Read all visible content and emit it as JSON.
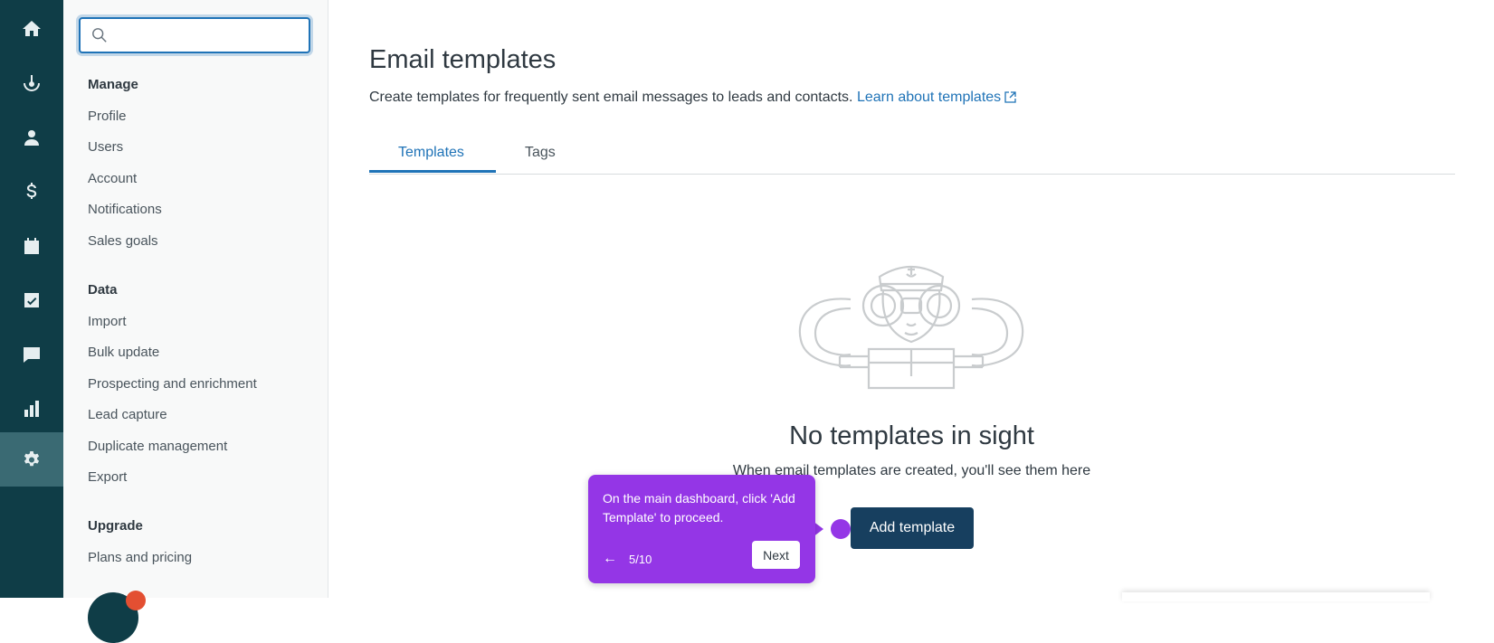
{
  "rail": {
    "items": [
      {
        "icon": "home-icon"
      },
      {
        "icon": "leads-icon"
      },
      {
        "icon": "contact-icon"
      },
      {
        "icon": "dollar-icon"
      },
      {
        "icon": "calendar-icon"
      },
      {
        "icon": "tasks-icon"
      },
      {
        "icon": "chat-icon"
      },
      {
        "icon": "reports-icon"
      },
      {
        "icon": "settings-icon",
        "active": true
      }
    ]
  },
  "sidebar": {
    "search": {
      "value": "",
      "placeholder": ""
    },
    "sections": [
      {
        "title": "Manage",
        "items": [
          "Profile",
          "Users",
          "Account",
          "Notifications",
          "Sales goals"
        ]
      },
      {
        "title": "Data",
        "items": [
          "Import",
          "Bulk update",
          "Prospecting and enrichment",
          "Lead capture",
          "Duplicate management",
          "Export"
        ]
      },
      {
        "title": "Upgrade",
        "items": [
          "Plans and pricing"
        ]
      }
    ]
  },
  "main": {
    "title": "Email templates",
    "description": "Create templates for frequently sent email messages to leads and contacts.",
    "learn_link": "Learn about templates",
    "tabs": [
      {
        "label": "Templates",
        "selected": true
      },
      {
        "label": "Tags",
        "selected": false
      }
    ],
    "empty_state": {
      "title": "No templates in sight",
      "subtitle": "When email templates are created, you'll see them here",
      "button": "Add template"
    }
  },
  "tour": {
    "text": "On the main dashboard, click 'Add Template' to proceed.",
    "back_glyph": "←",
    "step": "5/10",
    "next_label": "Next"
  },
  "colors": {
    "rail_bg": "#0f3d47",
    "accent": "#1f73b7",
    "button_bg": "#173f5f",
    "tour_bg": "#9436e6"
  }
}
